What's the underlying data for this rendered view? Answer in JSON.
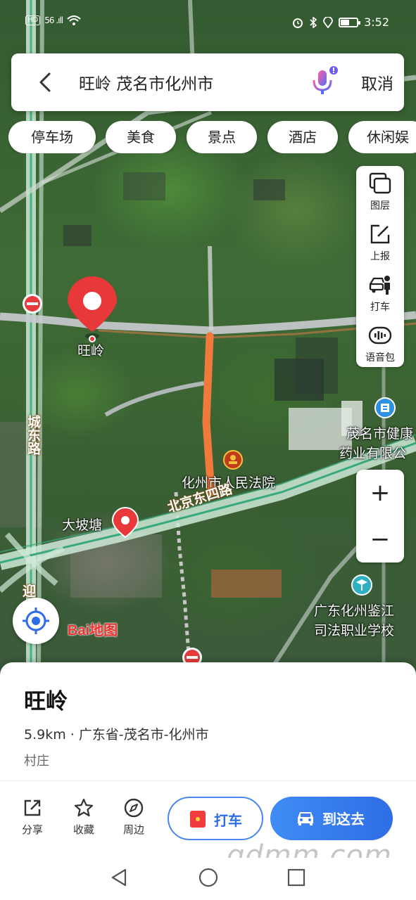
{
  "status_bar": {
    "left_badge": "HD",
    "signal_text": "56 .ıll",
    "time": "3:52",
    "battery_level": 0.55
  },
  "search": {
    "query": "旺岭 茂名市化州市",
    "cancel_label": "取消"
  },
  "categories": [
    "停车场",
    "美食",
    "景点",
    "酒店",
    "休闲娱"
  ],
  "tools": [
    {
      "label": "图层",
      "icon": "layers-icon"
    },
    {
      "label": "上报",
      "icon": "report-icon"
    },
    {
      "label": "打车",
      "icon": "taxi-person-icon"
    },
    {
      "label": "语音包",
      "icon": "voice-pack-icon"
    }
  ],
  "zoom": {
    "in": "+",
    "out": "−"
  },
  "map": {
    "pin_label": "旺岭",
    "poi_dapotang": "大坡塘",
    "poi_court": "化州市人民法院",
    "poi_company_line1": "茂名市健康",
    "poi_company_line2": "药业有限公",
    "poi_school_line1": "广东化州鉴江",
    "poi_school_line2": "司法职业学校",
    "road_beijing": "北京东四路",
    "road_chengdong": "城东路",
    "road_ying": "迎",
    "logo_text": "Bai地图",
    "route_color": "#f07a3c",
    "pin_color": "#e8383a"
  },
  "place": {
    "name": "旺岭",
    "detail": "5.9km · 广东省-茂名市-化州市",
    "type": "村庄"
  },
  "actions": {
    "share": "分享",
    "favorite": "收藏",
    "nearby": "周边",
    "taxi": "打车",
    "go": "到这去"
  },
  "watermark": "gdmm.com"
}
